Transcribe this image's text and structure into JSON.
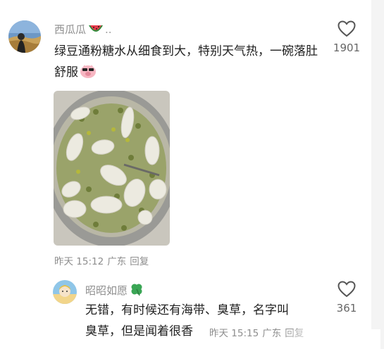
{
  "comments": [
    {
      "username": "西瓜瓜",
      "username_suffix": "..",
      "username_emoji": "watermelon-emoji",
      "text": "绿豆通粉糖水从细食到大，特别天气热，一碗落肚舒服",
      "text_emoji": "pig-face-sunglasses-emoji",
      "photo": "bowl-mung-bean-pasta-dessert",
      "time": "昨天 15:12",
      "location": "广东",
      "reply_label": "回复",
      "likes": "1901"
    },
    {
      "username": "昭昭如愿",
      "username_emoji": "four-leaf-clover-emoji",
      "text_lines": [
        "无错，有时候还有海带、臭草，名字叫",
        "臭草，但是闻着很香"
      ],
      "time": "昨天 15:15",
      "location": "广东",
      "reply_label": "回复",
      "likes": "361"
    }
  ],
  "colors": {
    "meta": "#8e8e8e",
    "text": "#1f1f1f",
    "background": "#ffffff"
  }
}
